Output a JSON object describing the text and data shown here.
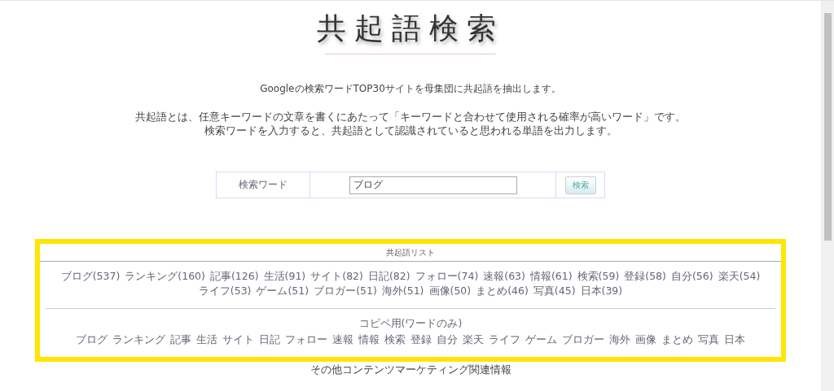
{
  "logo": {
    "title": "共起語検索"
  },
  "intro": {
    "lead": "Googleの検索ワードTOP30サイトを母集団に共起語を抽出します。",
    "lines": [
      "共起語とは、任意キーワードの文章を書くにあたって「キーワードと合わせて使用される確率が高いワード」です。",
      "検索ワードを入力すると、共起語として認識されていると思われる単語を出力します。"
    ]
  },
  "search": {
    "label": "検索ワード",
    "value": "ブログ",
    "button": "検索"
  },
  "results": {
    "heading": "共起語リスト",
    "words": [
      "ブログ(537)",
      "ランキング(160)",
      "記事(126)",
      "生活(91)",
      "サイト(82)",
      "日記(82)",
      "フォロー(74)",
      "速報(63)",
      "情報(61)",
      "検索(59)",
      "登録(58)",
      "自分(56)",
      "楽天(54)",
      "ライフ(53)",
      "ゲーム(51)",
      "ブロガー(51)",
      "海外(51)",
      "画像(50)",
      "まとめ(46)",
      "写真(45)",
      "日本(39)"
    ],
    "copy_heading": "コピペ用(ワードのみ)",
    "copy_words": [
      "ブログ",
      "ランキング",
      "記事",
      "生活",
      "サイト",
      "日記",
      "フォロー",
      "速報",
      "情報",
      "検索",
      "登録",
      "自分",
      "楽天",
      "ライフ",
      "ゲーム",
      "ブロガー",
      "海外",
      "画像",
      "まとめ",
      "写真",
      "日本"
    ]
  },
  "footer": {
    "heading": "その他コンテンツマーケティング関連情報"
  }
}
